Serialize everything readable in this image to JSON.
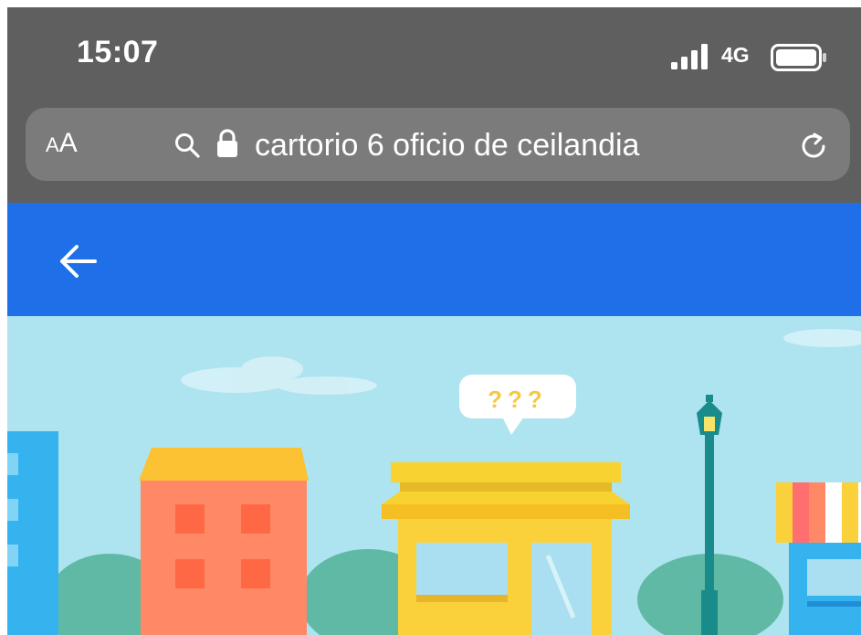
{
  "status_bar": {
    "time": "15:07",
    "network": "4G",
    "signal_icon": "signal-bars-icon",
    "battery_icon": "battery-icon"
  },
  "address_bar": {
    "text_size_button": {
      "small": "A",
      "large": "A"
    },
    "query": "cartorio 6 oficio de ceilandia",
    "search_icon": "search-icon",
    "lock_icon": "lock-icon",
    "reload_icon": "reload-icon"
  },
  "app_bar": {
    "back_icon": "back-arrow-icon",
    "color": "#1e6fe8"
  },
  "illustration": {
    "speech_bubble": "???",
    "sky_color": "#aee3f0"
  }
}
